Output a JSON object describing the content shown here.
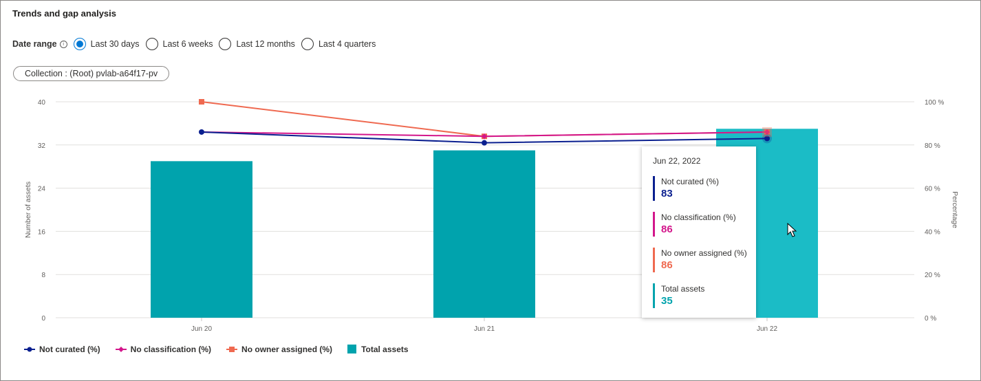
{
  "panel": {
    "title": "Trends and gap analysis"
  },
  "date_range": {
    "label": "Date range",
    "options": [
      "Last 30 days",
      "Last 6 weeks",
      "Last 12 months",
      "Last 4 quarters"
    ],
    "selected": "Last 30 days"
  },
  "filter": {
    "collection_label": "Collection : (Root) pvlab-a64f17-pv"
  },
  "chart_data": {
    "type": "bar",
    "categories": [
      "Jun 20",
      "Jun 21",
      "Jun 22"
    ],
    "ylabel": "Number of assets",
    "y2label": "Percentage",
    "ylim": [
      0,
      40
    ],
    "y2lim": [
      0,
      100
    ],
    "yticks": [
      "0",
      "8",
      "16",
      "24",
      "32",
      "40"
    ],
    "y2ticks": [
      "0 %",
      "20 %",
      "40 %",
      "60 %",
      "80 %",
      "100 %"
    ],
    "grid": true,
    "legend_position": "bottom-left",
    "bars": {
      "name": "Total assets",
      "values": [
        29,
        31,
        35
      ],
      "color": "#00a3ad",
      "highlight_color": "#1bbcc6"
    },
    "series": [
      {
        "name": "Not curated (%)",
        "values": [
          86,
          81,
          83
        ],
        "color": "#0a1f8f",
        "marker": "circle",
        "axis": "right"
      },
      {
        "name": "No classification (%)",
        "values": [
          86,
          84,
          86
        ],
        "color": "#d3168b",
        "marker": "diamond",
        "axis": "right"
      },
      {
        "name": "No owner assigned (%)",
        "values": [
          100,
          84,
          86
        ],
        "color": "#ef6950",
        "marker": "square",
        "axis": "right"
      }
    ]
  },
  "tooltip": {
    "date": "Jun 22, 2022",
    "items": [
      {
        "label": "Not curated (%)",
        "value": "83",
        "color": "#0a1f8f"
      },
      {
        "label": "No classification (%)",
        "value": "86",
        "color": "#d3168b"
      },
      {
        "label": "No owner assigned (%)",
        "value": "86",
        "color": "#ef6950"
      },
      {
        "label": "Total assets",
        "value": "35",
        "color": "#00a3ad"
      }
    ]
  },
  "legend": [
    {
      "label": "Not curated (%)",
      "color": "#0a1f8f",
      "marker": "circle"
    },
    {
      "label": "No classification (%)",
      "color": "#d3168b",
      "marker": "diamond"
    },
    {
      "label": "No owner assigned (%)",
      "color": "#ef6950",
      "marker": "square"
    },
    {
      "label": "Total assets",
      "color": "#00a3ad",
      "marker": "box"
    }
  ],
  "icons": {
    "info": "info-icon",
    "cursor": "mouse-pointer-icon"
  }
}
